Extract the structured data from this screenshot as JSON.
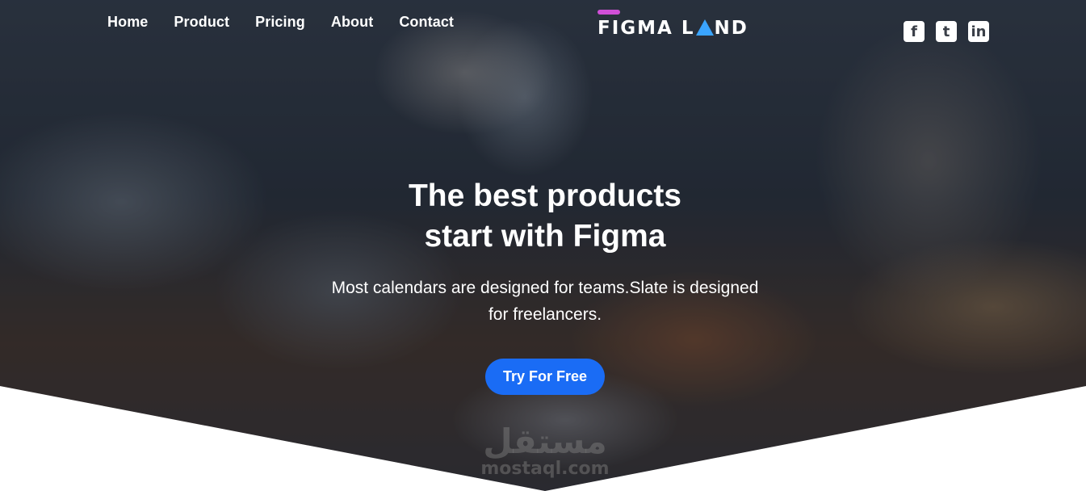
{
  "nav": {
    "items": [
      {
        "label": "Home"
      },
      {
        "label": "Product"
      },
      {
        "label": "Pricing"
      },
      {
        "label": "About"
      },
      {
        "label": "Contact"
      }
    ]
  },
  "logo": {
    "part1": "FIGMA L",
    "part2": "ND",
    "accent_bar_color": "#d04fd8",
    "triangle_color": "#3aa4ff"
  },
  "social": {
    "facebook": {
      "icon": "facebook-icon",
      "glyph": "f"
    },
    "twitter": {
      "icon": "twitter-icon",
      "glyph": "t"
    },
    "linkedin": {
      "icon": "linkedin-icon",
      "glyph": "in"
    }
  },
  "hero": {
    "headline_line1": "The best products",
    "headline_line2": "start with Figma",
    "sub_line1": "Most calendars are designed for teams.Slate is designed",
    "sub_line2": "for freelancers.",
    "cta_label": "Try For Free",
    "cta_color": "#1a6cf5"
  },
  "watermark": {
    "arabic": "مستقل",
    "latin": "mostaql.com"
  }
}
